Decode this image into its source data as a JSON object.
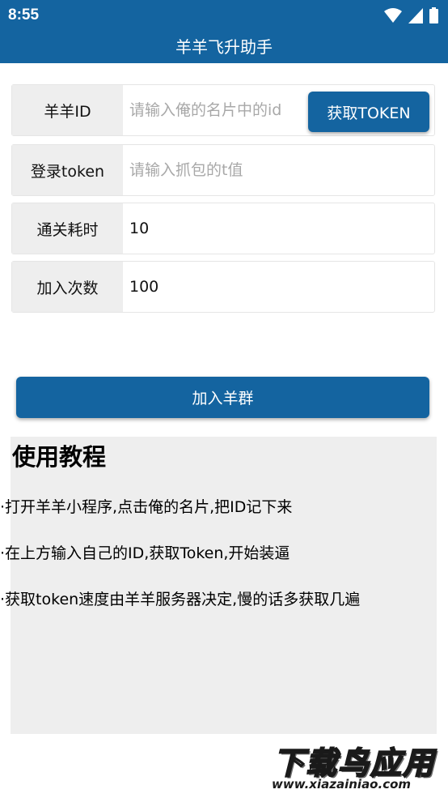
{
  "status_bar": {
    "time": "8:55"
  },
  "app_bar": {
    "title": "羊羊飞升助手"
  },
  "form": {
    "sheep_id": {
      "label": "羊羊ID",
      "value": "",
      "placeholder": "请输入俺的名片中的id",
      "button_label": "获取TOKEN"
    },
    "login_token": {
      "label": "登录token",
      "value": "",
      "placeholder": "请输入抓包的t值"
    },
    "clear_time": {
      "label": "通关耗时",
      "value": "10",
      "placeholder": ""
    },
    "join_count": {
      "label": "加入次数",
      "value": "100",
      "placeholder": ""
    }
  },
  "join_button": {
    "label": "加入羊群"
  },
  "tutorial": {
    "title": "使用教程",
    "items": [
      "·打开羊羊小程序,点击俺的名片,把ID记下来",
      "·在上方输入自己的ID,获取Token,开始装逼",
      "·获取token速度由羊羊服务器决定,慢的话多获取几遍"
    ]
  },
  "watermark": {
    "main": "下载鸟应用",
    "sub": "www.xiazainiao.com"
  }
}
